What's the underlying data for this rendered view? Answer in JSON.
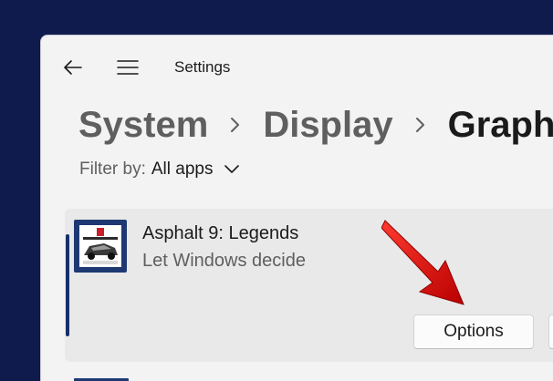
{
  "window": {
    "title": "Settings"
  },
  "navigation": {
    "back_icon": "back-arrow-icon",
    "menu_icon": "hamburger-menu-icon"
  },
  "breadcrumb": {
    "items": [
      "System",
      "Display",
      "Graphi"
    ],
    "separator_icon": "chevron-right-icon"
  },
  "filter": {
    "label": "Filter by:",
    "value": "All apps",
    "dropdown_icon": "chevron-down-icon"
  },
  "app_list": {
    "items": [
      {
        "name": "Asphalt 9: Legends",
        "preference": "Let Windows decide",
        "icon": "asphalt-app-icon",
        "options_label": "Options"
      }
    ]
  },
  "colors": {
    "desktop_background": "#0f1b4d",
    "window_background": "#f3f3f3",
    "card_background": "#e9e9e9",
    "selection_indicator": "#16306a",
    "annotation_arrow": "#d10000"
  },
  "annotation": {
    "icon": "red-pointer-arrow-icon"
  }
}
